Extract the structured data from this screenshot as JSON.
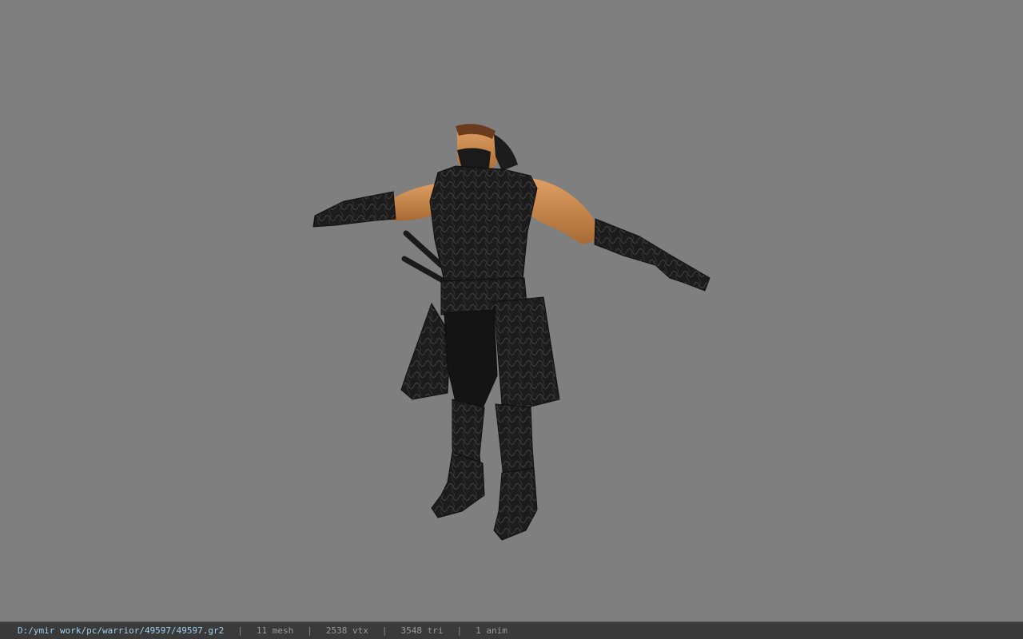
{
  "viewport": {
    "background_color": "#7f7f7f",
    "model": {
      "icon": "warrior-character-model",
      "skin_color": "#c98a4f",
      "armor_color": "#1e1e1e"
    }
  },
  "status_bar": {
    "file_path": "D:/ymir work/pc/warrior/49597/49597.gr2",
    "separator": "|",
    "mesh_count": "11 mesh",
    "vertex_count": "2538 vtx",
    "triangle_count": "3548 tri",
    "animation_count": "1 anim",
    "path_color": "#9fd0f0"
  }
}
